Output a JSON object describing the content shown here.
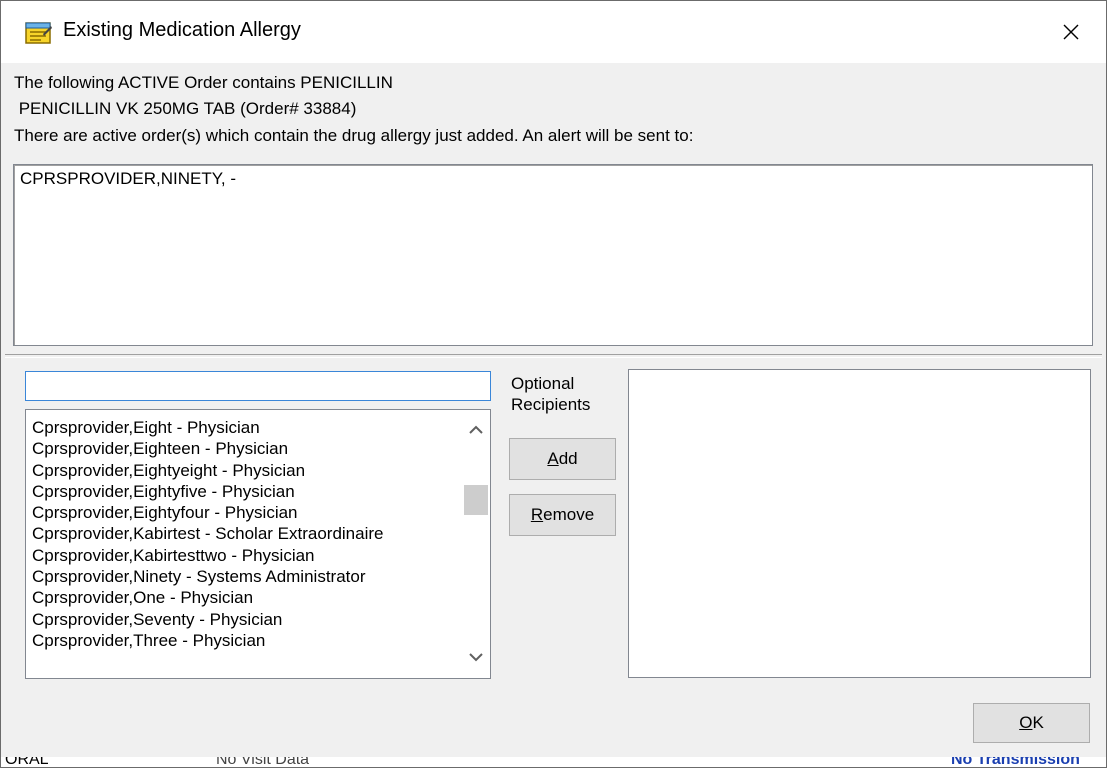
{
  "window": {
    "title": "Existing Medication Allergy",
    "icon": "notepad-icon",
    "close_icon": "close-icon"
  },
  "message": {
    "line1": "The following ACTIVE Order contains PENICILLIN",
    "line2": " PENICILLIN VK 250MG TAB (Order# 33884)",
    "line3": "There are active order(s) which contain the drug allergy just added. An alert will be sent to:"
  },
  "alert_recipients": [
    "CPRSPROVIDER,NINETY, -"
  ],
  "search": {
    "value": ""
  },
  "provider_list": [
    "Cprsprovider,Eight - Physician",
    "Cprsprovider,Eighteen - Physician",
    "Cprsprovider,Eightyeight - Physician",
    "Cprsprovider,Eightyfive - Physician",
    "Cprsprovider,Eightyfour - Physician",
    "Cprsprovider,Kabirtest - Scholar Extraordinaire",
    "Cprsprovider,Kabirtesttwo - Physician",
    "Cprsprovider,Ninety - Systems Administrator",
    "Cprsprovider,One - Physician",
    "Cprsprovider,Seventy - Physician",
    "Cprsprovider,Three - Physician"
  ],
  "optional_label": {
    "line1": "Optional",
    "line2": "Recipients"
  },
  "buttons": {
    "add": {
      "mnemonic": "A",
      "rest": "dd"
    },
    "remove": {
      "mnemonic": "R",
      "rest": "emove"
    },
    "ok": {
      "mnemonic": "O",
      "rest": "K"
    }
  },
  "status_strip": {
    "left": "ORAL",
    "middle": "No Visit Data",
    "right": "No Transmission"
  },
  "colors": {
    "accent": "#3a86d8",
    "status_right": "#1a3fb0"
  }
}
